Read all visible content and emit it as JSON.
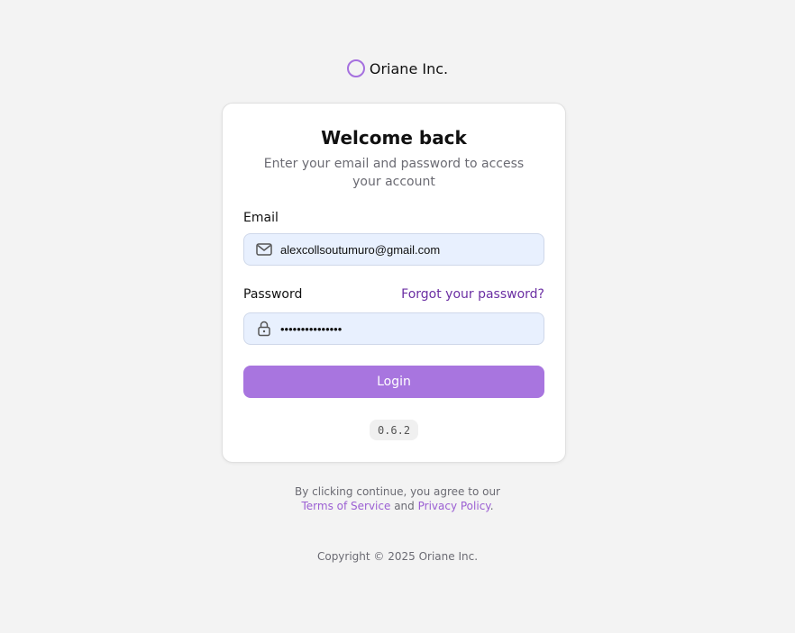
{
  "brand": {
    "name": "Oriane Inc.",
    "accent_color": "#a570df"
  },
  "login_card": {
    "title": "Welcome back",
    "subtitle": "Enter your email and password to access your account",
    "email": {
      "label": "Email",
      "value": "alexcollsoutumuro@gmail.com",
      "icon": "mail-icon"
    },
    "password": {
      "label": "Password",
      "value": "•••••••••••••••",
      "icon": "lock-icon",
      "forgot_link": "Forgot your password?"
    },
    "login_button": "Login",
    "button_color": "#a875df",
    "version": "0.6.2"
  },
  "legal": {
    "prefix": "By clicking continue, you agree to our",
    "terms_link": "Terms of Service",
    "conjunction": "and",
    "privacy_link": "Privacy Policy",
    "suffix": "."
  },
  "footer": {
    "copyright": "Copyright © 2025 Oriane Inc."
  }
}
